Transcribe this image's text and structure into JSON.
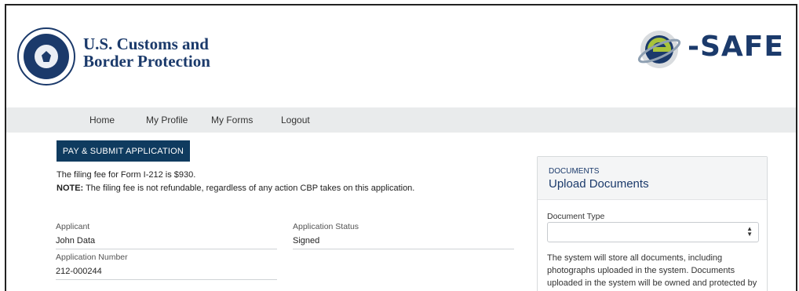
{
  "header": {
    "agency_line1": "U.S. Customs and",
    "agency_line2": "Border Protection",
    "logo_text": "-SAFE",
    "seal_icon": "dhs-seal-icon",
    "logo_icon": "e-safe-logo-icon"
  },
  "nav": {
    "items": [
      {
        "label": "Home"
      },
      {
        "label": "My Profile"
      },
      {
        "label": "My Forms"
      },
      {
        "label": "Logout"
      }
    ]
  },
  "main": {
    "pay_button": "PAY & SUBMIT APPLICATION",
    "fee_text": "The filing fee for Form I-212 is $930.",
    "note_label": "NOTE:",
    "note_text": " The filing fee is not refundable, regardless of any action CBP takes on this application.",
    "applicant_label": "Applicant",
    "applicant_value": "John Data",
    "status_label": "Application Status",
    "status_value": "Signed",
    "number_label": "Application Number",
    "number_value": "212-000244"
  },
  "documents": {
    "kicker": "DOCUMENTS",
    "title": "Upload Documents",
    "type_label": "Document Type",
    "type_value": "",
    "description": "The system will store all documents, including photographs uploaded in the system. Documents uploaded in the system will be owned and protected by"
  },
  "colors": {
    "brand_navy": "#1b3a6b",
    "button_bg": "#0f3b5f",
    "nav_bg": "#e9ebec"
  }
}
